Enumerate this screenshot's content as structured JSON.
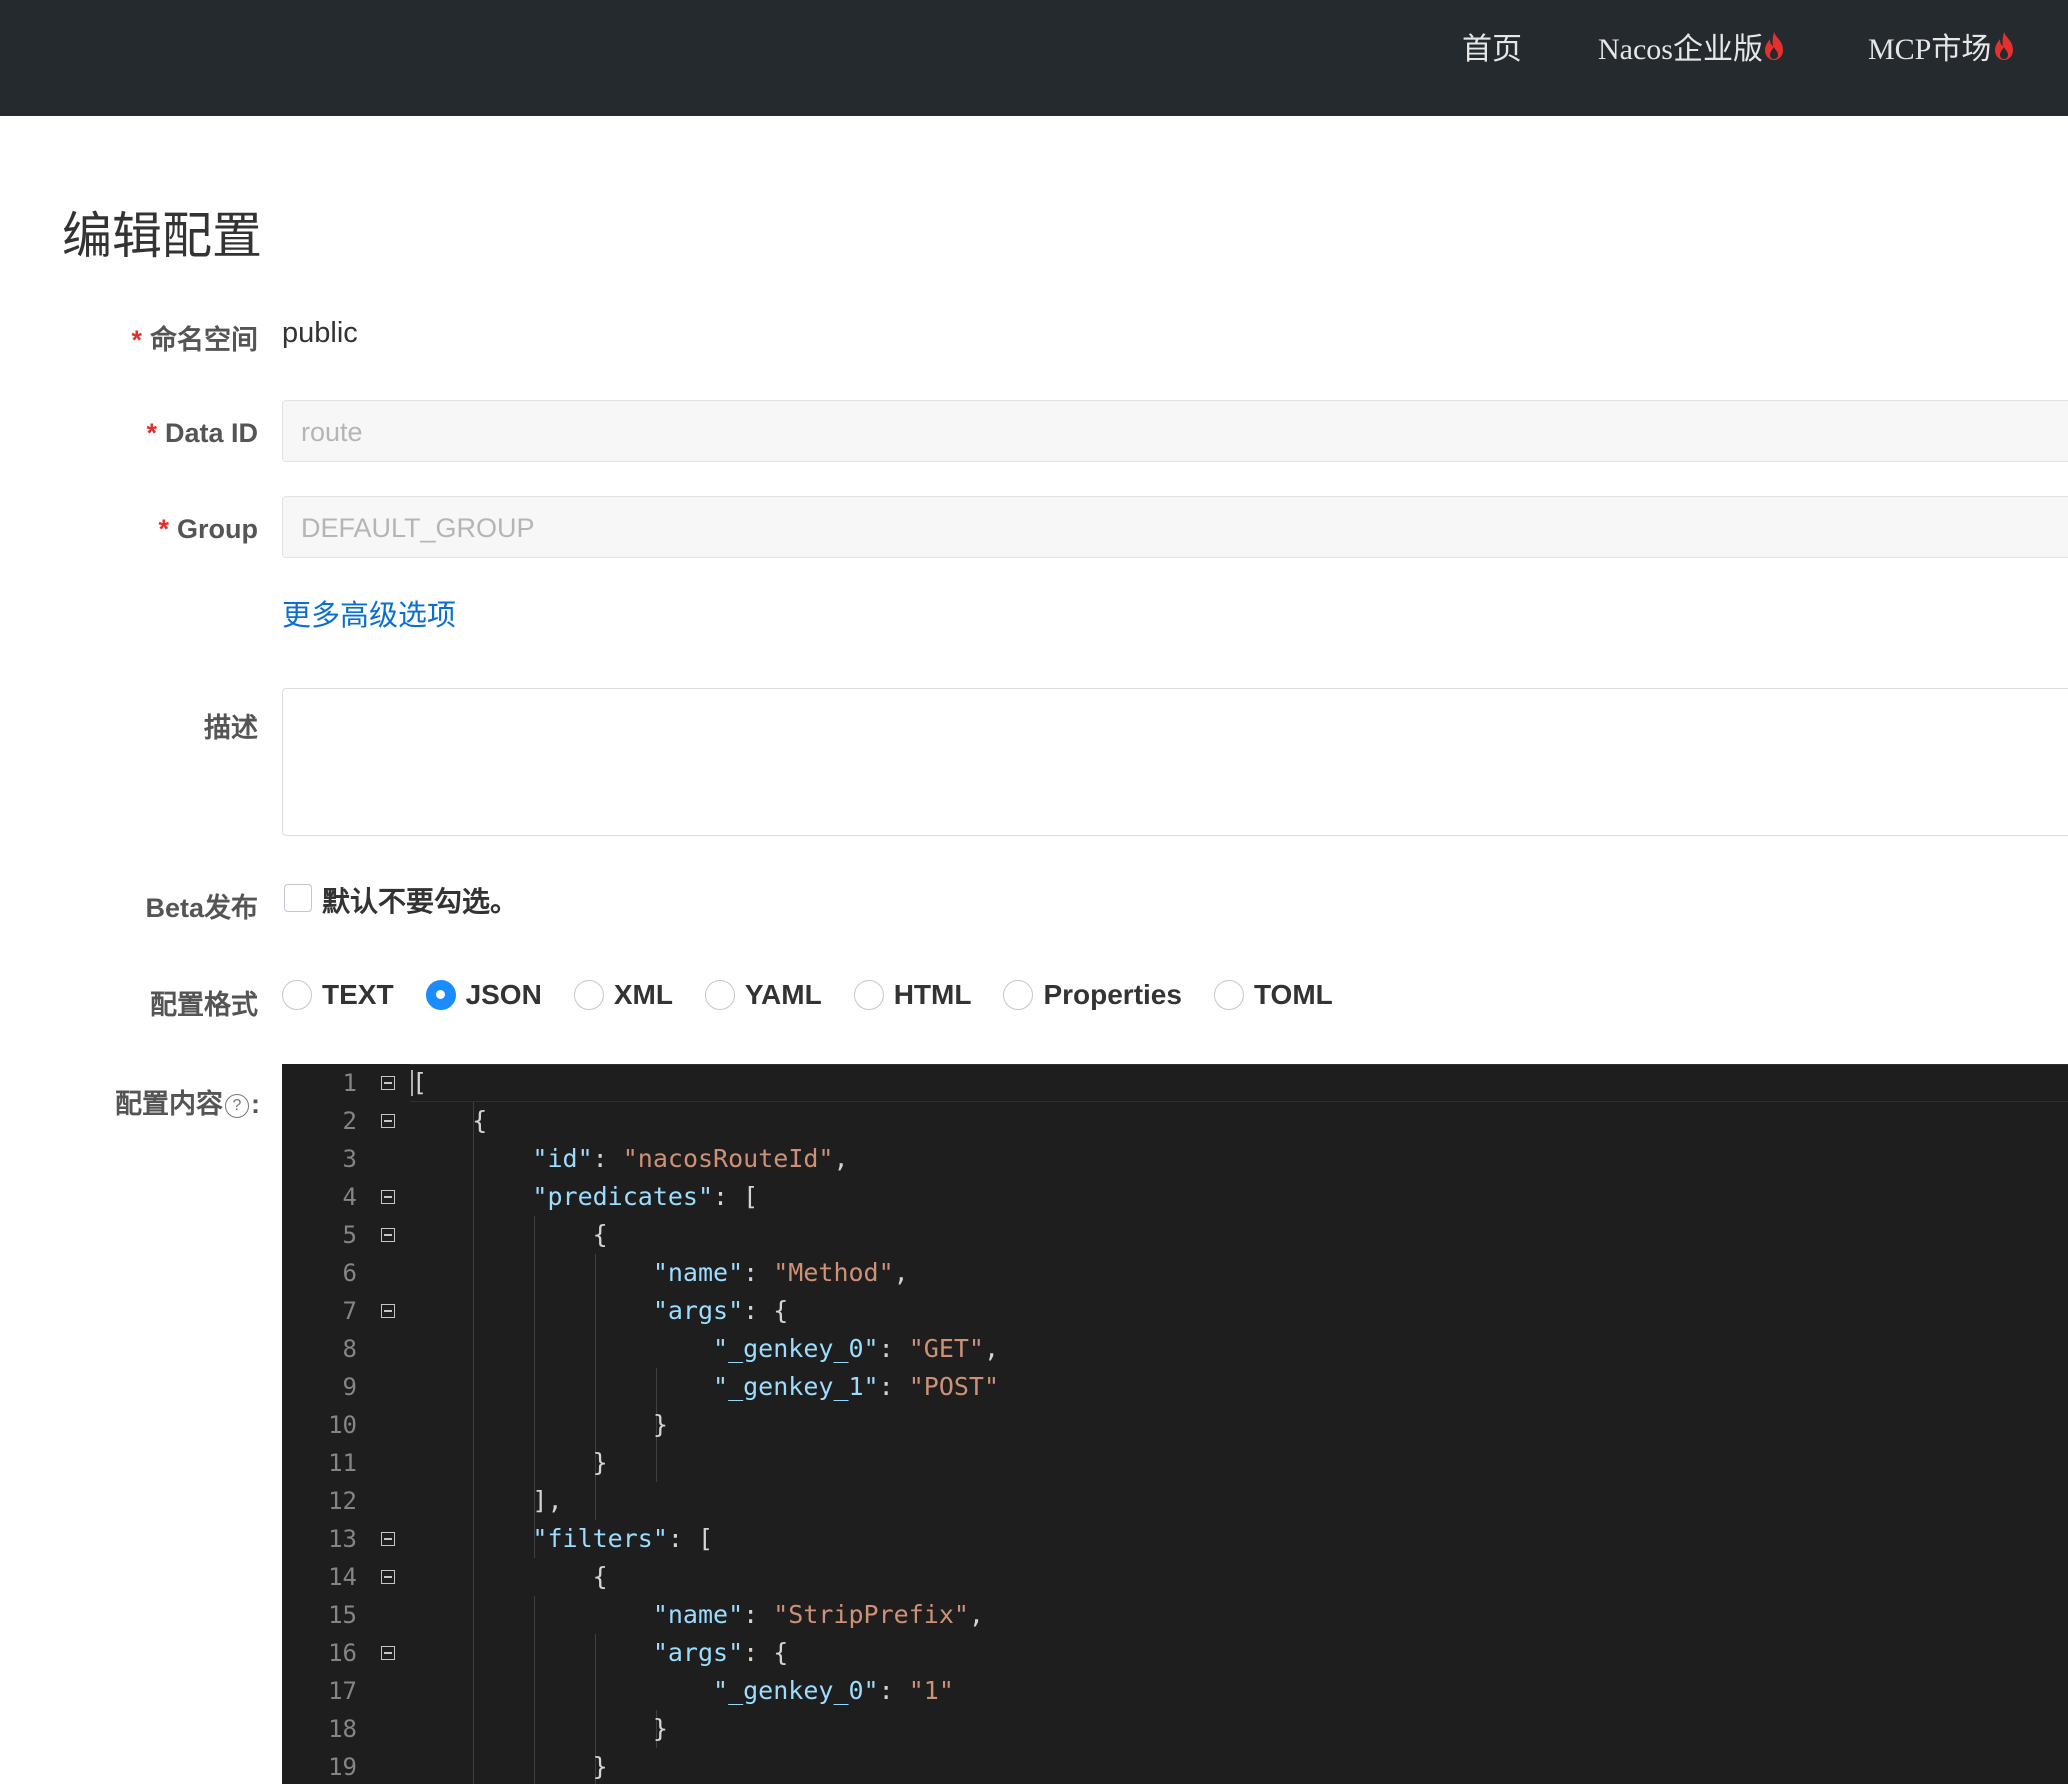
{
  "nav": {
    "home": "首页",
    "enterprise": "Nacos企业版",
    "mcp": "MCP市场"
  },
  "page": {
    "title": "编辑配置"
  },
  "form": {
    "namespace": {
      "label": "命名空间",
      "value": "public"
    },
    "data_id": {
      "label": "Data ID",
      "value": "route"
    },
    "group": {
      "label": "Group",
      "value": "DEFAULT_GROUP"
    },
    "advanced_link": "更多高级选项",
    "description": {
      "label": "描述",
      "value": ""
    },
    "beta": {
      "label": "Beta发布",
      "checkbox_label": "默认不要勾选。",
      "checked": false
    },
    "format": {
      "label": "配置格式",
      "options": [
        "TEXT",
        "JSON",
        "XML",
        "YAML",
        "HTML",
        "Properties",
        "TOML"
      ],
      "selected": "JSON"
    },
    "content": {
      "label": "配置内容",
      "colon": ":",
      "help_icon": "question-circle-icon"
    }
  },
  "editor": {
    "line_numbers": [
      "1",
      "2",
      "3",
      "4",
      "5",
      "6",
      "7",
      "8",
      "9",
      "10",
      "11",
      "12",
      "13",
      "14",
      "15",
      "16",
      "17",
      "18",
      "19"
    ],
    "lines": [
      "[",
      "    {",
      "        \"id\": \"nacosRouteId\",",
      "        \"predicates\": [",
      "            {",
      "                \"name\": \"Method\",",
      "                \"args\": {",
      "                    \"_genkey_0\": \"GET\",",
      "                    \"_genkey_1\": \"POST\"",
      "                }",
      "            }",
      "        ],",
      "        \"filters\": [",
      "            {",
      "                \"name\": \"StripPrefix\",",
      "                \"args\": {",
      "                    \"_genkey_0\": \"1\"",
      "                }",
      "            }"
    ]
  },
  "colors": {
    "topbar": "#252a2f",
    "accent": "#1a8cff",
    "link": "#0a6fd0",
    "required": "#e22e2e",
    "flame": "#e5302e",
    "editor_bg": "#1e1e1e",
    "json_key": "#9cdcfe",
    "json_string": "#ce9178"
  }
}
